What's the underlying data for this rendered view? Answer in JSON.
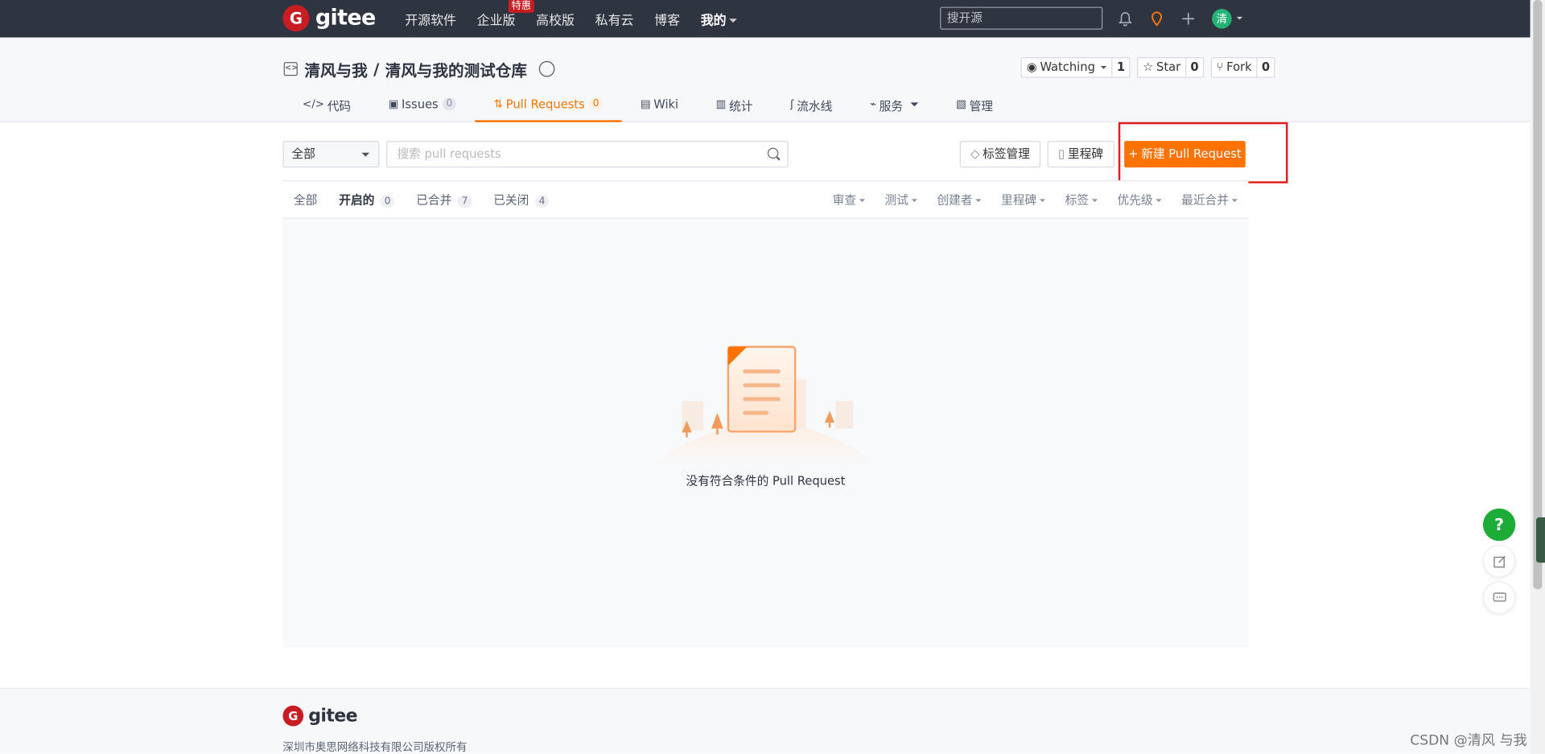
{
  "nav": {
    "logo_text": "gitee",
    "links": [
      "开源软件",
      "企业版",
      "高校版",
      "私有云",
      "博客",
      "我的"
    ],
    "hot_badge": "特惠",
    "search_placeholder": "搜开源",
    "avatar_text": "清",
    "icons": [
      "bell-icon",
      "location-pin-icon",
      "plus-icon"
    ]
  },
  "repo": {
    "owner": "清风与我",
    "separator": "/",
    "name": "清风与我的测试仓库",
    "watching_label": "Watching",
    "watching_count": "1",
    "star_label": "Star",
    "star_count": "0",
    "fork_label": "Fork",
    "fork_count": "0"
  },
  "tabs": [
    {
      "label": "代码",
      "icon": "code-icon"
    },
    {
      "label": "Issues",
      "count": "0",
      "icon": "issues-icon"
    },
    {
      "label": "Pull Requests",
      "count": "0",
      "icon": "pull-request-icon",
      "active": true
    },
    {
      "label": "Wiki",
      "icon": "wiki-icon"
    },
    {
      "label": "统计",
      "icon": "chart-icon"
    },
    {
      "label": "流水线",
      "icon": "pipeline-icon"
    },
    {
      "label": "服务",
      "icon": "service-icon"
    },
    {
      "label": "管理",
      "icon": "manage-icon"
    }
  ],
  "toolbar": {
    "select_value": "全部",
    "search_placeholder": "搜索 pull requests",
    "labels_button": "标签管理",
    "milestone_button": "里程碑",
    "new_pr_button": "新建 Pull Request"
  },
  "filters": {
    "left": [
      {
        "label": "全部"
      },
      {
        "label": "开启的",
        "count": "0",
        "active": true
      },
      {
        "label": "已合并",
        "count": "7"
      },
      {
        "label": "已关闭",
        "count": "4"
      }
    ],
    "right": [
      "审查",
      "测试",
      "创建者",
      "里程碑",
      "标签",
      "优先级",
      "最近合并"
    ]
  },
  "empty": {
    "message": "没有符合条件的 Pull Request"
  },
  "footer": {
    "logo_text": "gitee",
    "copyright": "深圳市奥思网络科技有限公司版权所有"
  },
  "float": {
    "help": "?"
  },
  "watermark": "CSDN @清风 与我",
  "colors": {
    "brand": "#c71d23",
    "accent": "#fe7300",
    "nav_bg": "#2f3441",
    "help": "#1cac37",
    "highlight": "#e31b1b"
  }
}
